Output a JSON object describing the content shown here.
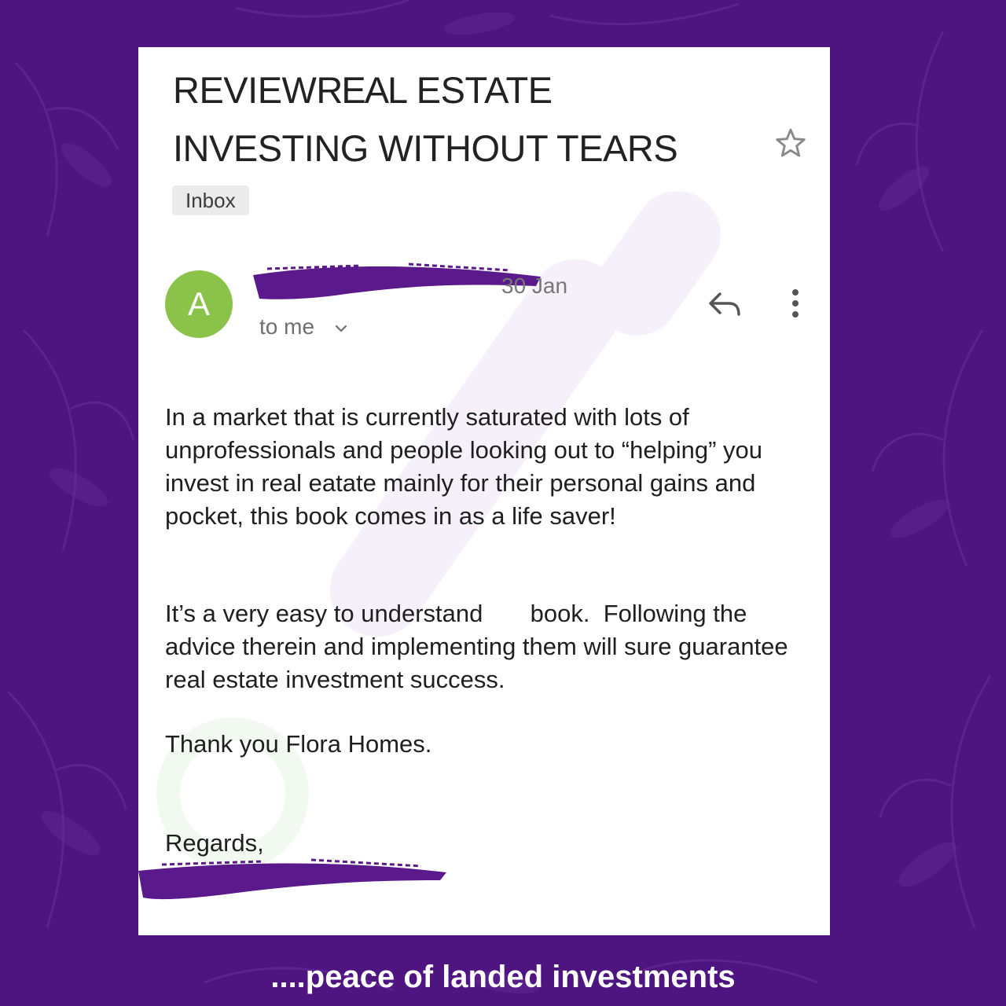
{
  "email": {
    "subject_line1_part1": "REVIEW",
    "subject_line1_part2": "REAL",
    "subject_line1_part3": "ESTATE",
    "subject_line2": "INVESTING WITHOUT TEARS",
    "label": "Inbox",
    "sender_initial": "A",
    "date": "30 Jan",
    "recipient": "to me",
    "body_paragraph_1": "In a market that is currently saturated with lots of unprofessionals and people looking out to “helping” you invest in real eatate mainly for their personal gains and pocket, this book comes in as a life saver!",
    "body_paragraph_2": "It’s a very easy to understand       book.  Following the advice therein and implementing them will sure guarantee real estate investment success.",
    "body_paragraph_3": "Thank you Flora Homes.",
    "signoff": "Regards,"
  },
  "footer": {
    "tagline": "....peace of landed investments"
  },
  "colors": {
    "background": "#4e1480",
    "avatar": "#8bc34a",
    "redaction": "#5a1a8c"
  },
  "icons": [
    "star-icon",
    "reply-icon",
    "more-vert-icon",
    "chevron-down-icon"
  ]
}
